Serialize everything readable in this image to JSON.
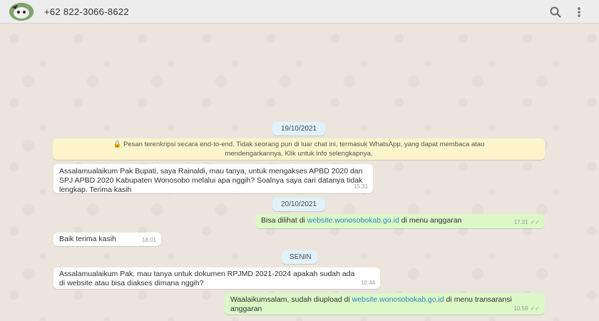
{
  "header": {
    "contact_name": "+62 822-3066-8622",
    "icons": [
      "avatar",
      "search-icon",
      "menu-icon"
    ]
  },
  "dates": {
    "d1": "19/10/2021",
    "d2": "20/10/2021",
    "d3": "SENIN"
  },
  "system": {
    "encryption_notice_line1": "🔒 Pesan terenkripsi secara end-to-end. Tidak seorang pun di luar chat ini, termasuk WhatsApp, yang dapat membaca atau",
    "encryption_notice_line2": "mendengarkannya. Klik untuk info selengkapnya."
  },
  "messages": [
    {
      "direction": "in",
      "text": "Assalamualaikum Pak Bupati, saya Rainaldi, mau tanya, untuk mengakses  APBD 2020 dan SPJ APBD 2020 Kabupaten Wonosobo melalui apa nggih? Soalnya saya cari datanya tidak lengkap. Terima kasih",
      "time": "15.31"
    },
    {
      "direction": "out",
      "text_before": "Bisa dilihat di ",
      "link": "website.wonosobokab.go.id",
      "text_after": " di menu anggaran",
      "time": "17.31"
    },
    {
      "direction": "in",
      "text": "Baik terima kasih",
      "time": "18.01"
    },
    {
      "direction": "in",
      "text": "Assalamualaikum Pak, mau tanya untuk dokumen RPJMD 2021-2024 apakah sudah ada di website atau bisa diakses dimana nggih?",
      "time": "10.44"
    },
    {
      "direction": "out",
      "text_before": "Waalaikumsalam, sudah  diupload di ",
      "link": "website.wonosobokab.go.id",
      "text_after": " di menu transaransi anggaran",
      "time": "10.59"
    }
  ],
  "colors": {
    "header_bg": "#ededed",
    "chat_bg": "#ece5dd",
    "incoming_bubble": "#ffffff",
    "outgoing_bubble": "#dcf8c6",
    "date_pill": "#e1f2fb",
    "system_notice": "#fcf4cb",
    "link": "#2f86c5"
  }
}
